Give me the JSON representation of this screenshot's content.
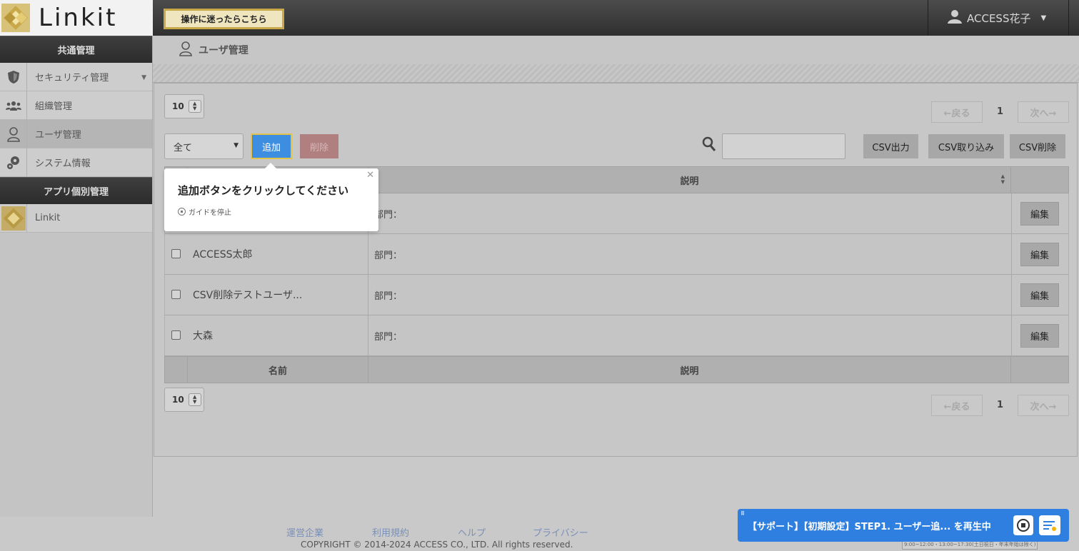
{
  "header": {
    "logo_text": "Linkit",
    "guide_button": "操作に迷ったらこちら",
    "user_name": "ACCESS花子"
  },
  "sidebar": {
    "common_heading": "共通管理",
    "items": [
      {
        "label": "セキュリティ管理"
      },
      {
        "label": "組織管理"
      },
      {
        "label": "ユーザ管理"
      },
      {
        "label": "システム情報"
      }
    ],
    "app_heading": "アプリ個別管理",
    "app_items": [
      {
        "label": "Linkit"
      }
    ]
  },
  "main": {
    "title": "ユーザ管理",
    "per_page": "10",
    "pager": {
      "prev": "←戻る",
      "page": "1",
      "next": "次へ→"
    },
    "filter_value": "全て",
    "add_label": "追加",
    "delete_label": "削除",
    "csv_export": "CSV出力",
    "csv_import": "CSV取り込み",
    "csv_delete": "CSV削除",
    "columns": {
      "name": "名前",
      "desc": "説明"
    },
    "rows": [
      {
        "name": "",
        "desc": "部門：",
        "edit": "編集"
      },
      {
        "name": "ACCESS太郎",
        "desc": "部門：",
        "edit": "編集"
      },
      {
        "name": "CSV削除テストユーザ...",
        "desc": "部門：",
        "edit": "編集"
      },
      {
        "name": "大森",
        "desc": "部門：",
        "edit": "編集"
      }
    ]
  },
  "tooltip": {
    "message": "追加ボタンをクリックしてください",
    "stop_label": "ガイドを停止"
  },
  "footer": {
    "links": [
      "運営企業",
      "利用規約",
      "ヘルプ",
      "プライバシー"
    ],
    "copyright": "COPYRIGHT © 2014-2024 ACCESS CO., LTD. All rights reserved.",
    "hours": "9:00~12:00・13:00~17:30(土日祝日・年末年始は除く)"
  },
  "support": {
    "text": "【サポート】【初期設定】STEP1. ユーザー追... を再生中"
  },
  "colors": {
    "accent_blue": "#3d8de0",
    "gold": "#c9a84a",
    "support_blue": "#2f7fe0"
  }
}
